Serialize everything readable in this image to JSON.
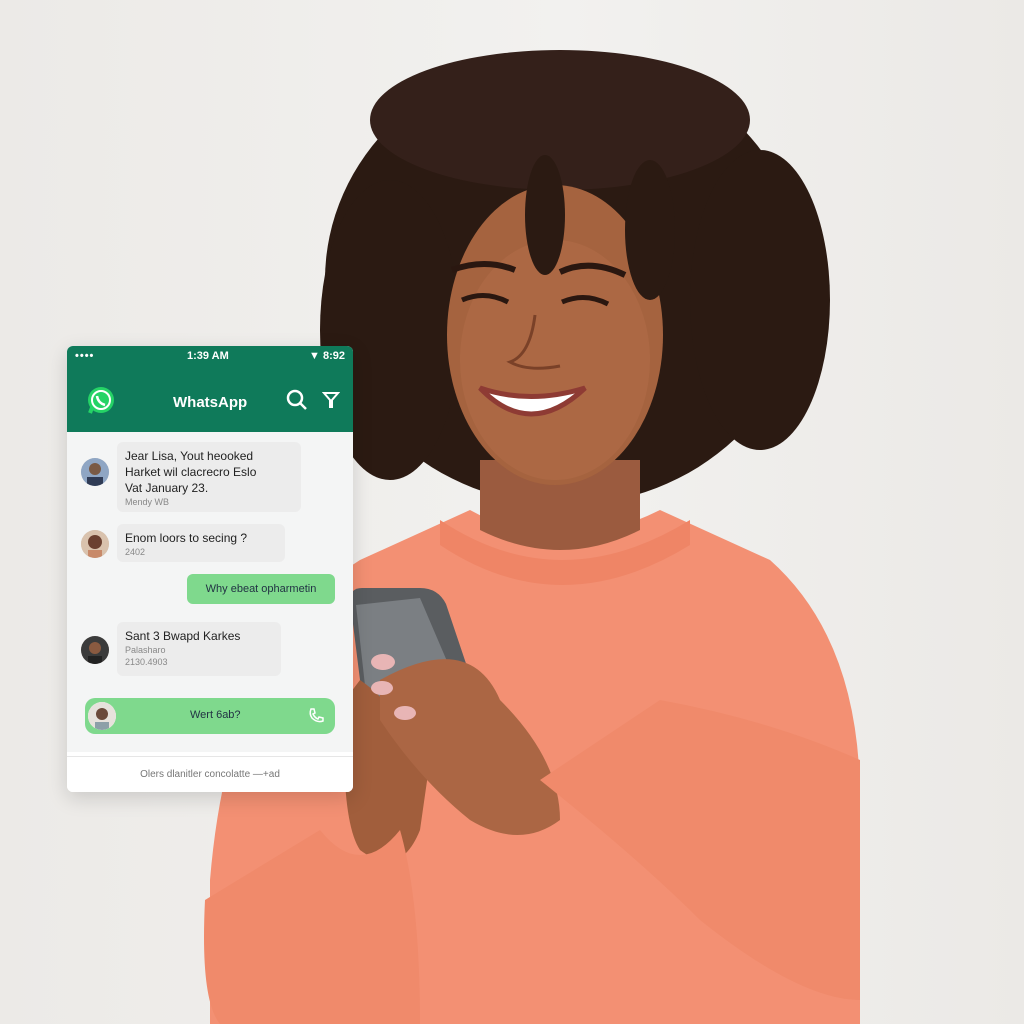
{
  "status_bar": {
    "signal": "••••",
    "time": "1:39 AM",
    "right": "▼ 8:92"
  },
  "app": {
    "title": "WhatsApp"
  },
  "chats": [
    {
      "text": [
        "Jear Lisa, Yout heooked",
        "Harket wil clacrecro Eslo",
        "Vat January 23."
      ],
      "meta": "Mendy WB"
    },
    {
      "text": [
        "Enom loors to secing ?"
      ],
      "meta": "2402"
    },
    {
      "text": [
        "Why ebeat opharmetin"
      ],
      "meta": ""
    },
    {
      "text": [
        "Sant 3 Bwapd Karkes"
      ],
      "meta": "Palasharo",
      "meta2": "2130.4903"
    }
  ],
  "compose": {
    "text": "Wert 6ab?"
  },
  "footer": {
    "text": "Olers dlanitler concolatte —+ad"
  },
  "colors": {
    "brand": "#0f7a5a",
    "bubble_out": "#7fd98d",
    "sweater": "#f39073"
  }
}
